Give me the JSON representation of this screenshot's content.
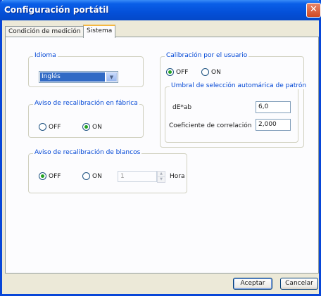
{
  "window": {
    "title": "Configuración portátil",
    "close_glyph": "✕"
  },
  "tabs": [
    {
      "label": "Condición de medición",
      "active": false
    },
    {
      "label": "Sistema",
      "active": true
    }
  ],
  "idioma": {
    "legend": "Idioma",
    "selected": "Inglés"
  },
  "factory_recal": {
    "legend": "Aviso de recalibración en fábrica",
    "off_label": "OFF",
    "on_label": "ON",
    "selected": "ON"
  },
  "white_recal": {
    "legend": "Aviso de recalibración de blancos",
    "off_label": "OFF",
    "on_label": "ON",
    "selected": "OFF",
    "value": "1",
    "unit": "Hora"
  },
  "user_cal": {
    "legend": "Calibración por el usuario",
    "off_label": "OFF",
    "on_label": "ON",
    "selected": "OFF",
    "threshold": {
      "legend": "Umbral de selección automárica de patrón",
      "de_label": "dE*ab",
      "de_value": "6,0",
      "corr_label": "Coeficiente de correlación",
      "corr_value": "2,000"
    }
  },
  "footer": {
    "ok_label": "Aceptar",
    "cancel_label": "Cancelar"
  },
  "colors": {
    "title_bar": "#0450d9",
    "group_legend": "#0046d5",
    "selection": "#316ac5",
    "radio_check": "#21a121"
  }
}
